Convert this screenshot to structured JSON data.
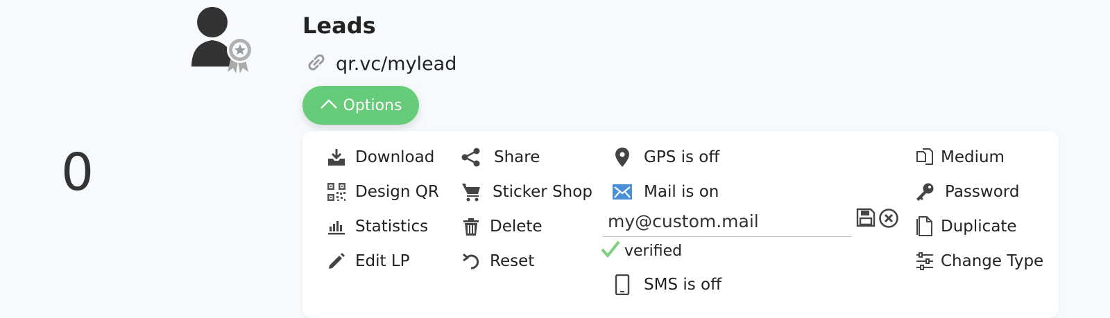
{
  "counter": "0",
  "title": "Leads",
  "link": "qr.vc/mylead",
  "options_label": "Options",
  "column1": [
    {
      "label": "Download",
      "icon": "download-icon"
    },
    {
      "label": "Design QR",
      "icon": "qr-code-icon"
    },
    {
      "label": "Statistics",
      "icon": "bar-chart-icon"
    },
    {
      "label": "Edit LP",
      "icon": "pencil-icon"
    }
  ],
  "column2": [
    {
      "label": "Share",
      "icon": "share-icon"
    },
    {
      "label": "Sticker Shop",
      "icon": "cart-icon"
    },
    {
      "label": "Delete",
      "icon": "trash-icon"
    },
    {
      "label": "Reset",
      "icon": "undo-icon"
    }
  ],
  "column3": {
    "gps": "GPS is off",
    "mail": "Mail is on",
    "mail_value": "my@custom.mail",
    "verified": "verified",
    "sms": "SMS is off"
  },
  "column4": [
    {
      "label": "Medium",
      "icon": "copy-pages-icon"
    },
    {
      "label": "Password",
      "icon": "key-icon"
    },
    {
      "label": "Duplicate",
      "icon": "document-icon"
    },
    {
      "label": "Change Type",
      "icon": "sliders-icon"
    }
  ],
  "colors": {
    "accent_green": "#66cc7a",
    "mail_blue": "#4a90d9",
    "verified_green": "#7ed07f",
    "icon_dark": "#444444"
  }
}
